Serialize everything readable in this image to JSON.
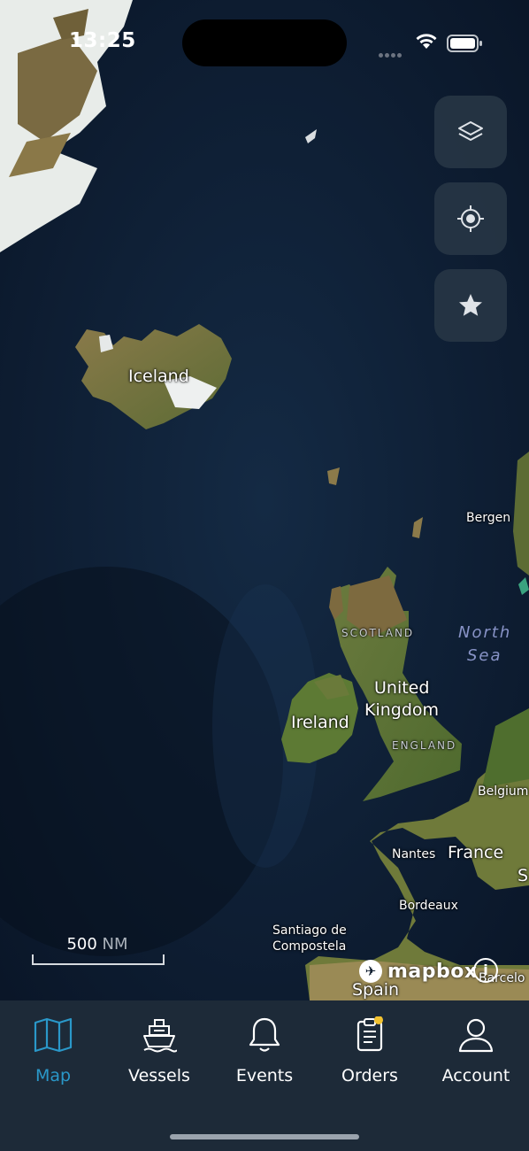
{
  "status_bar": {
    "time": "13:25"
  },
  "map": {
    "labels": {
      "iceland": "Iceland",
      "bergen": "Bergen",
      "scotland": "SCOTLAND",
      "north_sea_1": "North",
      "north_sea_2": "Sea",
      "united_kingdom_1": "United",
      "united_kingdom_2": "Kingdom",
      "ireland": "Ireland",
      "england": "ENGLAND",
      "belgium": "Belgium",
      "nantes": "Nantes",
      "france": "France",
      "bordeaux": "Bordeaux",
      "santiago_1": "Santiago de",
      "santiago_2": "Compostela",
      "spain": "Spain",
      "barcelona": "Barcelo",
      "edge_s": "S"
    },
    "scale": {
      "value": "500",
      "unit": "NM"
    },
    "attribution": "mapbox",
    "info_glyph": "i"
  },
  "controls": [
    {
      "name": "layers-button",
      "icon": "layers-icon"
    },
    {
      "name": "locate-button",
      "icon": "crosshair-icon"
    },
    {
      "name": "favorites-button",
      "icon": "star-icon"
    }
  ],
  "tabs": [
    {
      "label": "Map",
      "icon": "map-icon",
      "active": true
    },
    {
      "label": "Vessels",
      "icon": "ship-icon",
      "active": false
    },
    {
      "label": "Events",
      "icon": "bell-icon",
      "active": false
    },
    {
      "label": "Orders",
      "icon": "clipboard-icon",
      "active": false,
      "badge": true
    },
    {
      "label": "Account",
      "icon": "person-icon",
      "active": false
    }
  ],
  "colors": {
    "accent": "#2a98c9",
    "tabbar": "#1d2a38",
    "ocean": "#0c1a2c",
    "badge": "#f2c230"
  }
}
